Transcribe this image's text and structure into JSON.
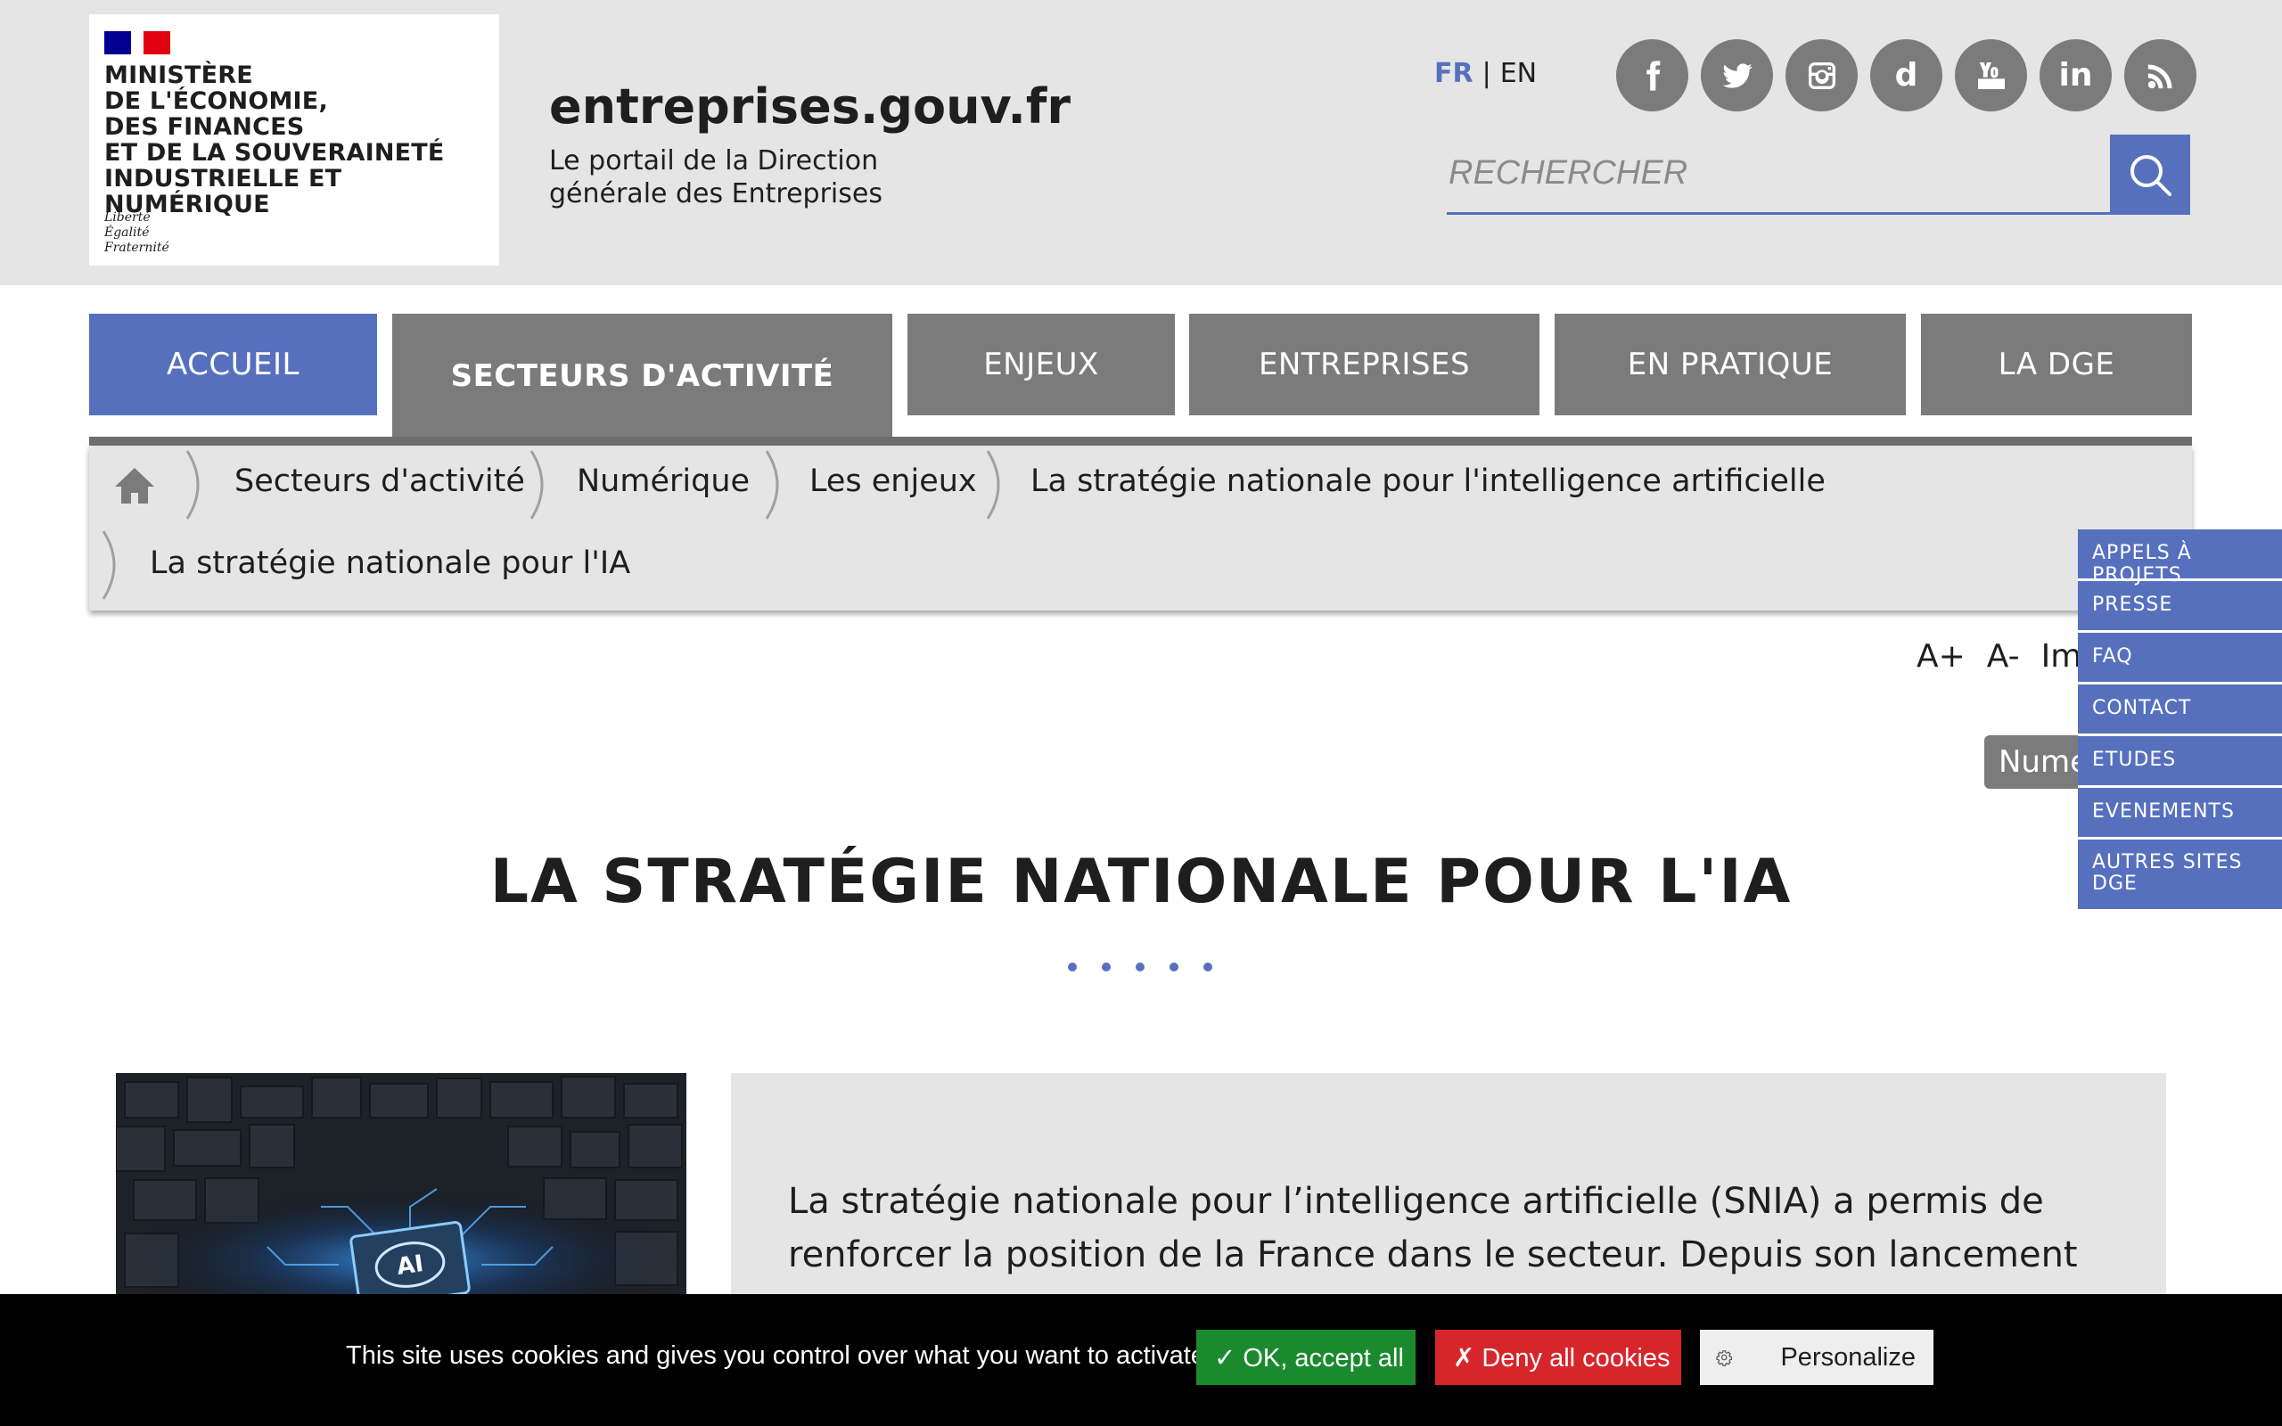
{
  "header": {
    "ministry_name": "Ministère\nde l'Économie,\ndes Finances\net de la Souveraineté\nindustrielle et numérique",
    "motto": "Liberté\nÉgalité\nFraternité",
    "site_title": "entreprises.gouv.fr",
    "site_subtitle": "Le portail de la Direction\ngénérale des Entreprises",
    "lang_fr": "FR",
    "lang_sep": "|",
    "lang_en": "EN",
    "socials": [
      "facebook-icon",
      "twitter-icon",
      "instagram-icon",
      "dailymotion-icon",
      "youtube-icon",
      "linkedin-icon",
      "rss-icon"
    ],
    "dailymotion_glyph": "d",
    "linkedin_glyph": "in",
    "search_placeholder": "RECHERCHER",
    "accent_color": "#5770be",
    "nav_color": "#7b7b7b"
  },
  "nav": {
    "home": "Accueil",
    "items": [
      "Secteurs d'activité",
      "Enjeux",
      "Entreprises",
      "En pratique",
      "La DGE"
    ]
  },
  "breadcrumb": {
    "items": [
      "Secteurs d'activité",
      "Numérique",
      "Les enjeux",
      "La stratégie nationale pour l'intelligence artificielle",
      "La stratégie nationale pour l'IA"
    ]
  },
  "side_menu": {
    "items": [
      "Appels à projets",
      "Presse",
      "FAQ",
      "Contact",
      "Etudes",
      "Evenements",
      "Autres sites DGE"
    ]
  },
  "tools": {
    "increase": "A+",
    "decrease": "A-",
    "print": "Imprimer"
  },
  "tag": "Numérique",
  "main": {
    "title": "La stratégie nationale pour l'IA",
    "intro": "La stratégie nationale pour l’intelligence artificielle (SNIA) a permis de renforcer la position de la France dans le secteur. Depuis son lancement en",
    "image_chip_label": "AI"
  },
  "cookie": {
    "message": "This site uses cookies and gives you control over what you want to activate",
    "ok": "✓ OK, accept all",
    "deny": "✗ Deny all cookies",
    "personalize": "Personalize"
  }
}
